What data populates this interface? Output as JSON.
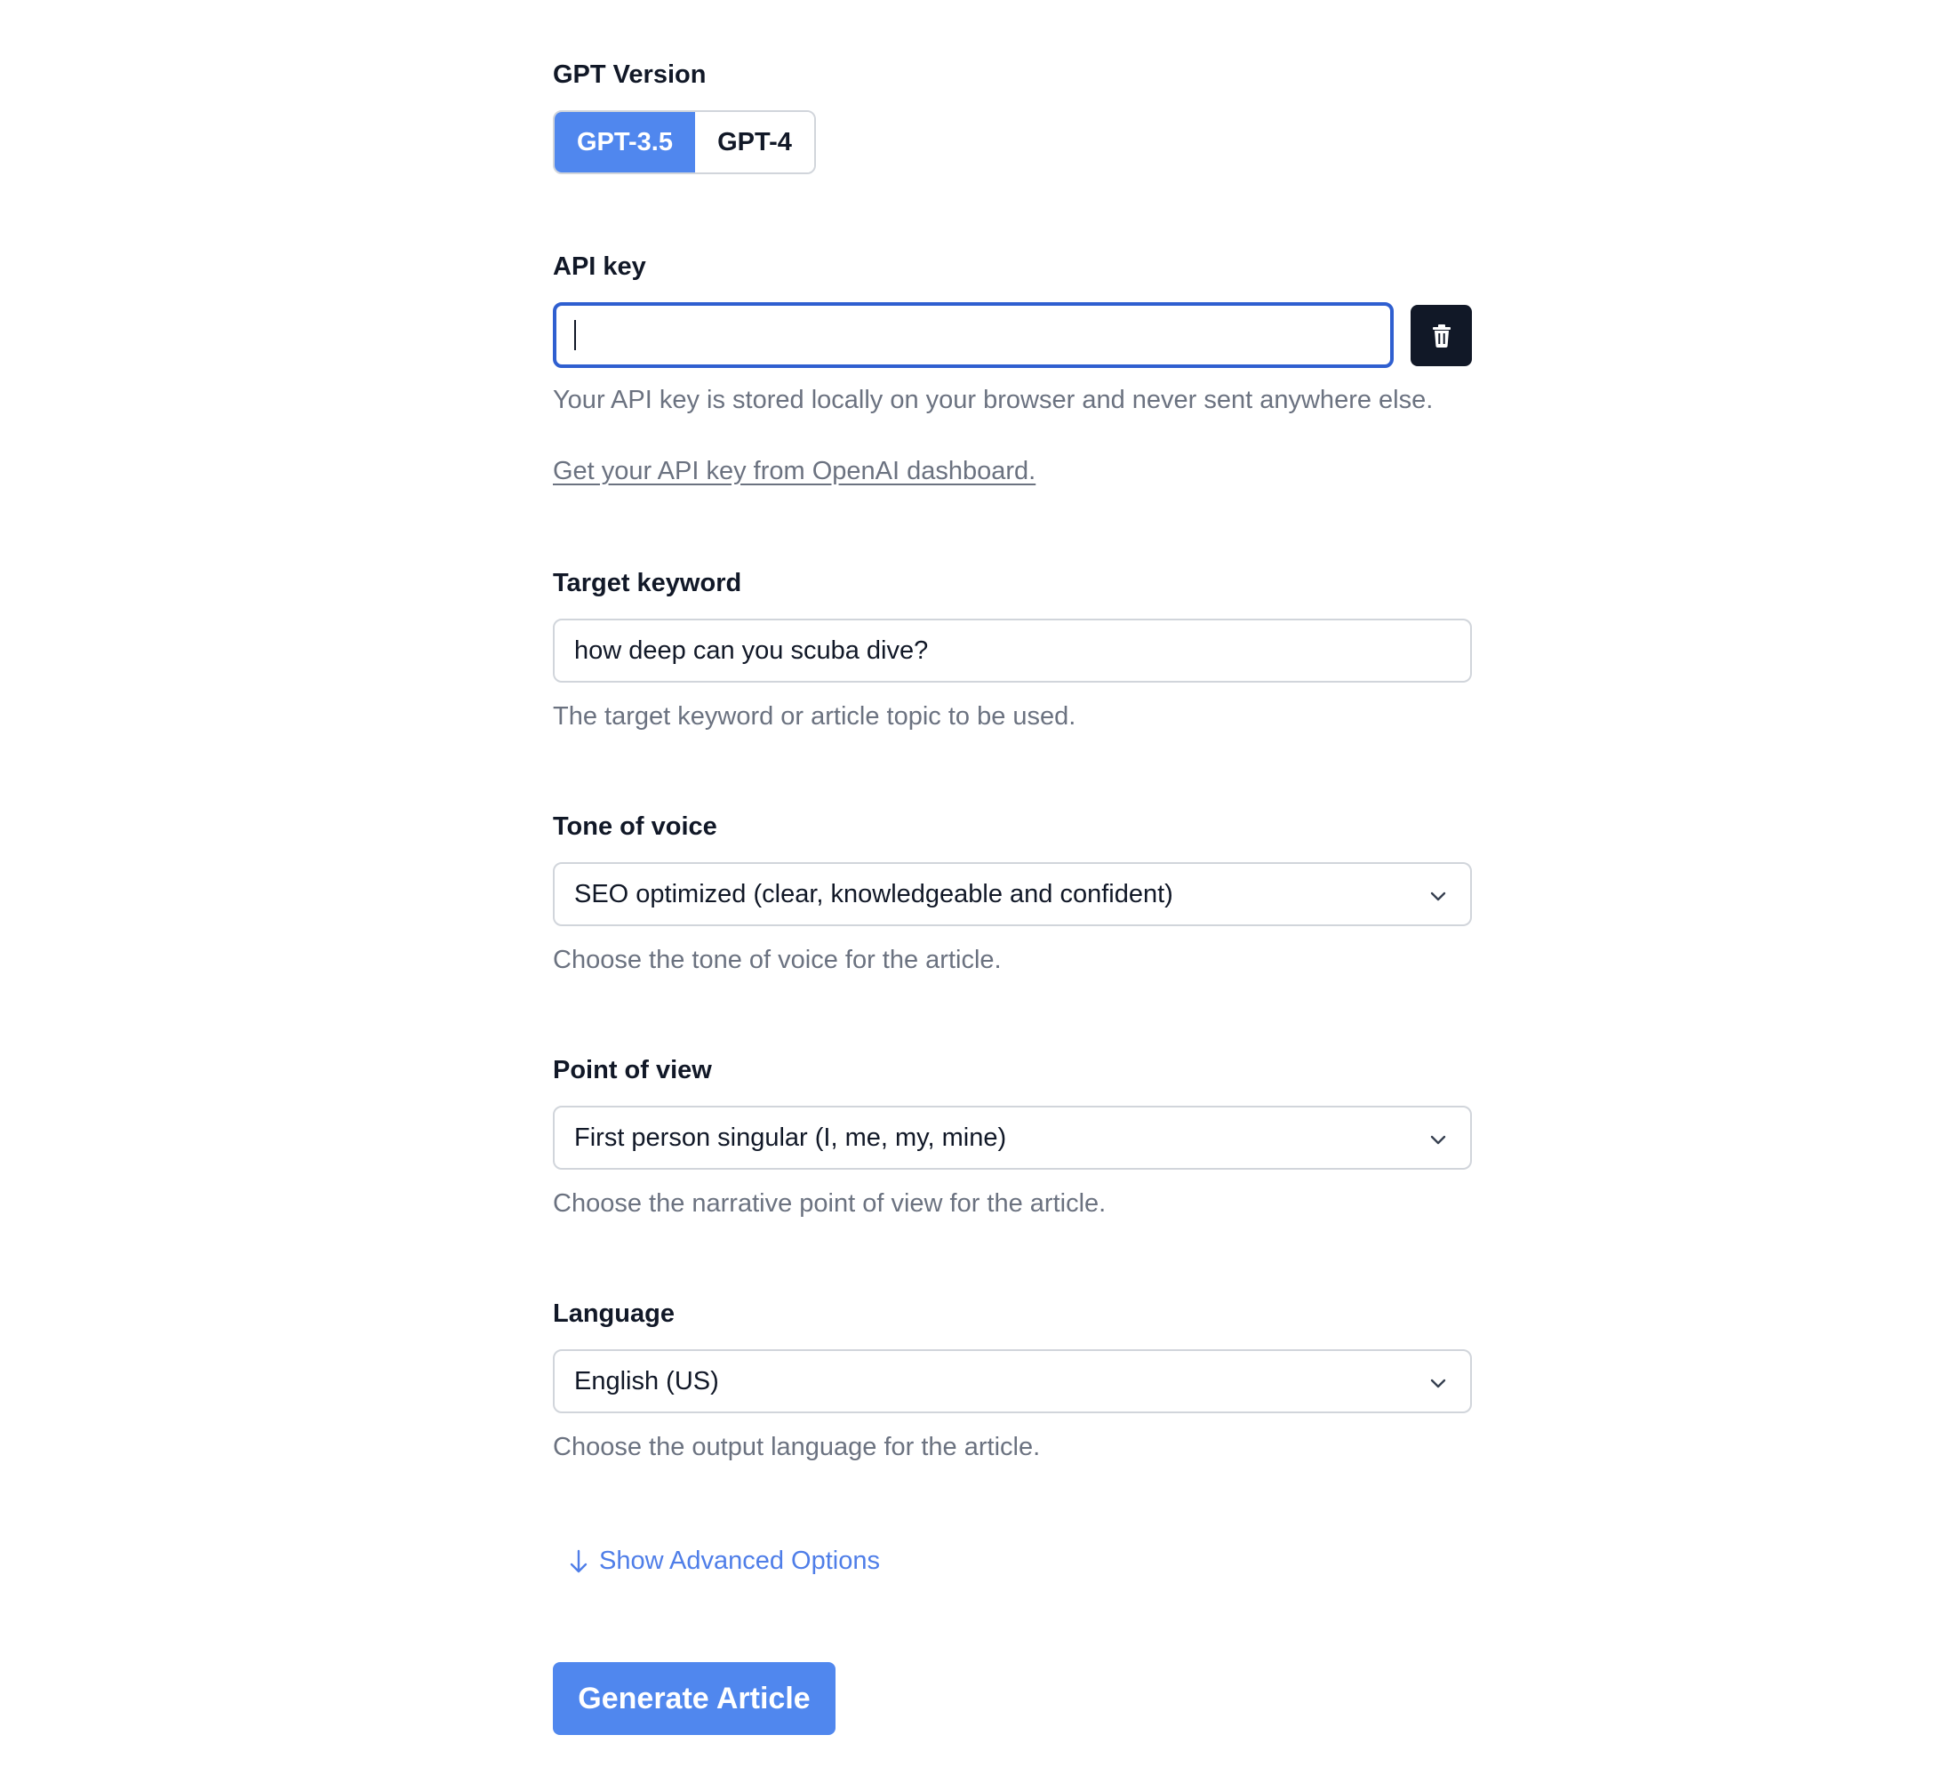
{
  "gpt_version": {
    "label": "GPT Version",
    "options": [
      {
        "label": "GPT-3.5",
        "selected": true
      },
      {
        "label": "GPT-4",
        "selected": false
      }
    ]
  },
  "api_key": {
    "label": "API key",
    "value": "",
    "note": "Your API key is stored locally on your browser and never sent anywhere else.",
    "link_text": "Get your API key from OpenAI dashboard.",
    "delete_icon": "trash-icon"
  },
  "target_keyword": {
    "label": "Target keyword",
    "value": "how deep can you scuba dive?",
    "hint": "The target keyword or article topic to be used."
  },
  "tone_of_voice": {
    "label": "Tone of voice",
    "value": "SEO optimized (clear, knowledgeable and confident)",
    "hint": "Choose the tone of voice for the article."
  },
  "point_of_view": {
    "label": "Point of view",
    "value": "First person singular (I, me, my, mine)",
    "hint": "Choose the narrative point of view for the article."
  },
  "language": {
    "label": "Language",
    "value": "English (US)",
    "hint": "Choose the output language for the article."
  },
  "advanced": {
    "label": "Show Advanced Options",
    "icon": "arrow-down-icon"
  },
  "generate_button": "Generate Article",
  "colors": {
    "accent": "#5087ee",
    "focus_border": "#2f5fd0",
    "dark_button": "#111827",
    "muted_text": "#6b7280",
    "link_accent": "#4f7ee8"
  }
}
